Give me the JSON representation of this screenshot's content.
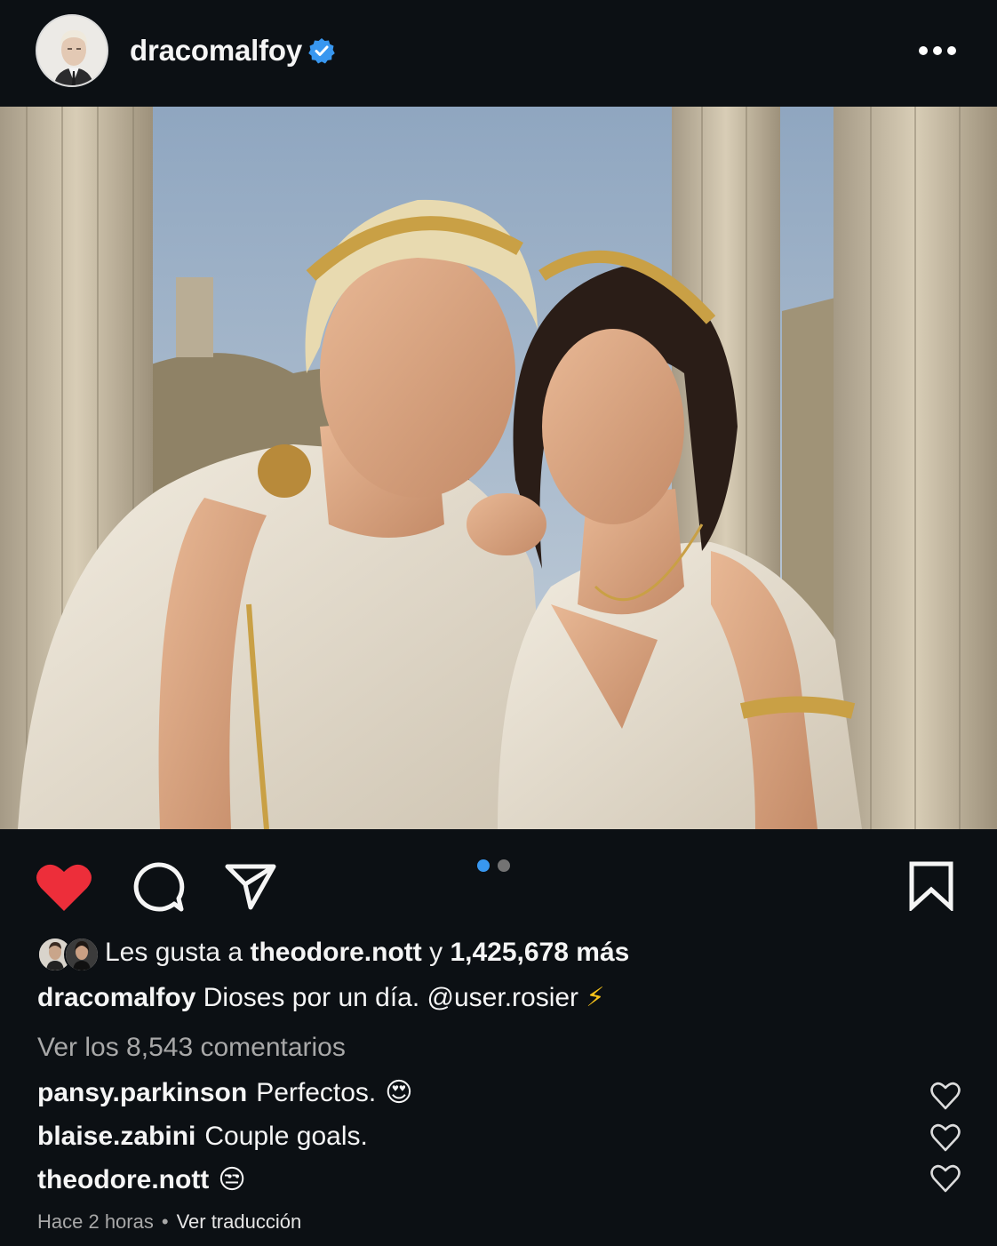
{
  "post": {
    "username": "dracomalfoy",
    "verified": true,
    "more_icon": "more-horizontal-icon"
  },
  "carousel": {
    "current": 1,
    "total": 2,
    "active_color": "#3897f0",
    "inactive_color": "#737373"
  },
  "actions": {
    "like_icon": "heart-filled-icon",
    "like_color": "#ed2e3a",
    "comment_icon": "comment-icon",
    "share_icon": "send-icon",
    "save_icon": "bookmark-icon"
  },
  "likes": {
    "prefix": "Les gusta a",
    "user": "theodore.nott",
    "joiner": "y",
    "count": "1,425,678",
    "suffix": "más"
  },
  "caption": {
    "username": "dracomalfoy",
    "text": "Dioses por un día. @user.rosier",
    "emoji": "⚡"
  },
  "view_comments": "Ver los 8,543 comentarios",
  "comments": [
    {
      "username": "pansy.parkinson",
      "text": "Perfectos.",
      "emoji": "😍"
    },
    {
      "username": "blaise.zabini",
      "text": "Couple goals.",
      "emoji": ""
    },
    {
      "username": "theodore.nott",
      "text": "",
      "emoji": "😒"
    }
  ],
  "footer": {
    "time": "Hace 2 horas",
    "separator": "•",
    "translate": "Ver traducción"
  }
}
